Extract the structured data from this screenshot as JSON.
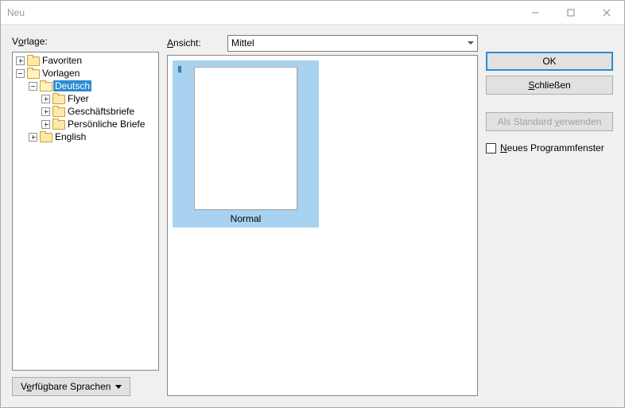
{
  "window": {
    "title": "Neu"
  },
  "left": {
    "label_pre": "V",
    "label_u": "o",
    "label_post": "rlage:",
    "tree": {
      "favoriten": "Favoriten",
      "vorlagen": "Vorlagen",
      "deutsch": "Deutsch",
      "flyer": "Flyer",
      "geschaeftsbriefe": "Geschäftsbriefe",
      "persoenliche": "Persönliche Briefe",
      "english": "English"
    },
    "langbtn_pre": "V",
    "langbtn_u": "e",
    "langbtn_post": "rfügbare Sprachen"
  },
  "mid": {
    "label_pre": "",
    "label_u": "A",
    "label_post": "nsicht:",
    "select_value": "Mittel",
    "thumb_label": "Normal"
  },
  "right": {
    "ok": "OK",
    "close_pre": "",
    "close_u": "S",
    "close_post": "chließen",
    "default_pre": "Als Standard ",
    "default_u": "v",
    "default_post": "erwenden",
    "newwin_u": "N",
    "newwin_post": "eues Programmfenster"
  }
}
